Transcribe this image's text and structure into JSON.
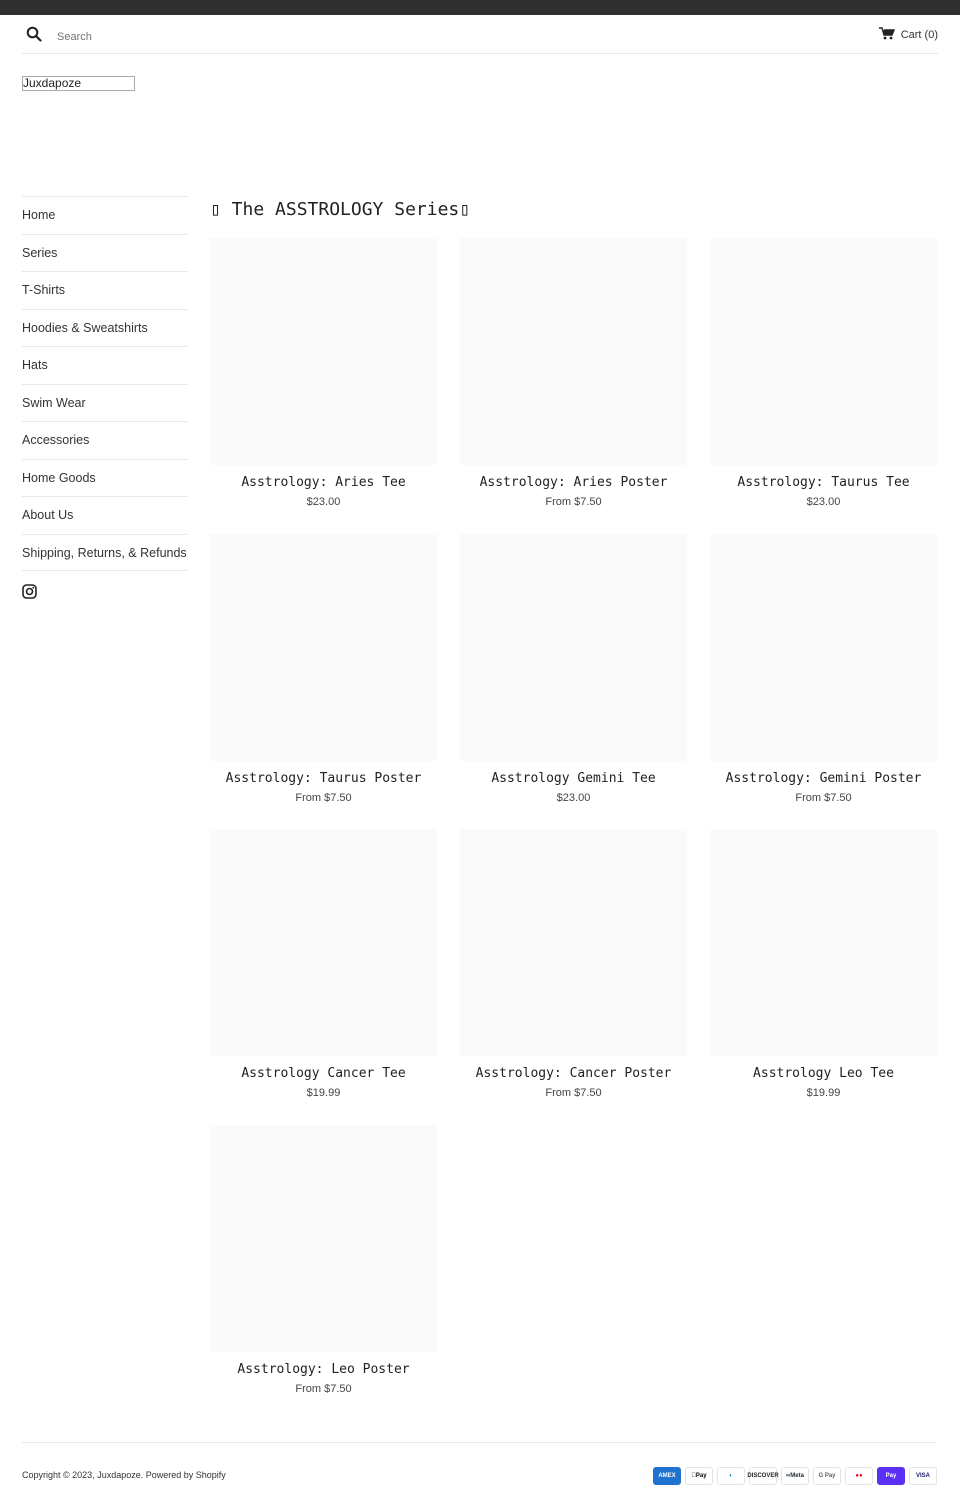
{
  "header": {
    "search_placeholder": "Search",
    "cart_label": "Cart",
    "cart_count": "(0)",
    "logo_text": "Juxdapoze"
  },
  "sidebar": {
    "items": [
      {
        "label": "Home"
      },
      {
        "label": "Series"
      },
      {
        "label": "T-Shirts"
      },
      {
        "label": "Hoodies & Sweatshirts"
      },
      {
        "label": "Hats"
      },
      {
        "label": "Swim Wear"
      },
      {
        "label": "Accessories"
      },
      {
        "label": "Home Goods"
      },
      {
        "label": "About Us"
      },
      {
        "label": "Shipping, Returns, & Refunds"
      }
    ],
    "social_icon": "instagram-icon"
  },
  "main": {
    "title": "▯ The ASSTROLOGY Series▯",
    "products": [
      {
        "title": "Asstrology: Aries Tee",
        "price": "$23.00"
      },
      {
        "title": "Asstrology: Aries Poster",
        "price": "From $7.50"
      },
      {
        "title": "Asstrology: Taurus Tee",
        "price": "$23.00"
      },
      {
        "title": "Asstrology: Taurus Poster",
        "price": "From $7.50"
      },
      {
        "title": "Asstrology Gemini Tee",
        "price": "$23.00"
      },
      {
        "title": "Asstrology: Gemini Poster",
        "price": "From $7.50"
      },
      {
        "title": "Asstrology Cancer Tee",
        "price": "$19.99"
      },
      {
        "title": "Asstrology: Cancer Poster",
        "price": "From $7.50"
      },
      {
        "title": "Asstrology Leo Tee",
        "price": "$19.99"
      },
      {
        "title": "Asstrology: Leo Poster",
        "price": "From $7.50"
      }
    ]
  },
  "footer": {
    "copyright_prefix": "Copyright © 2023, ",
    "brand_link": "Juxdapoze",
    "powered_by": ". Powered by Shopify",
    "payments": [
      {
        "name": "amex-icon",
        "label": "AMEX",
        "bg": "#1f72cd",
        "fg": "#ffffff"
      },
      {
        "name": "apple-pay-icon",
        "label": "Pay",
        "bg": "#ffffff",
        "fg": "#000000"
      },
      {
        "name": "diners-club-icon",
        "label": "◐",
        "bg": "#ffffff",
        "fg": "#0079be"
      },
      {
        "name": "discover-icon",
        "label": "DISCOVER",
        "bg": "#ffffff",
        "fg": "#231f20"
      },
      {
        "name": "meta-pay-icon",
        "label": "∞Meta",
        "bg": "#ffffff",
        "fg": "#1c2b33"
      },
      {
        "name": "google-pay-icon",
        "label": "G Pay",
        "bg": "#ffffff",
        "fg": "#5f6368"
      },
      {
        "name": "mastercard-icon",
        "label": "●●",
        "bg": "#ffffff",
        "fg": "#eb001b"
      },
      {
        "name": "shop-pay-icon",
        "label": "Pay",
        "bg": "#5a31f4",
        "fg": "#ffffff"
      },
      {
        "name": "visa-icon",
        "label": "VISA",
        "bg": "#ffffff",
        "fg": "#1a1f71"
      }
    ]
  }
}
